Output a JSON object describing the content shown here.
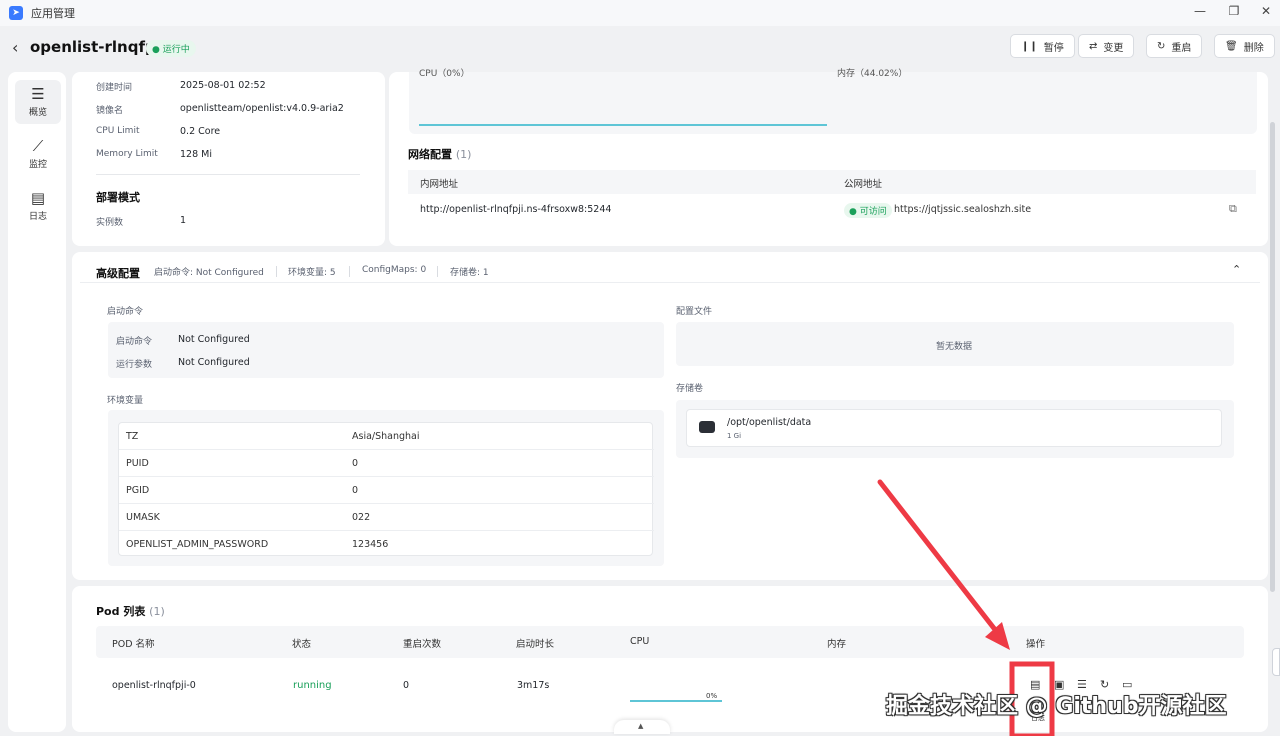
{
  "window": {
    "title": "应用管理"
  },
  "header": {
    "app_name": "openlist-rlnqfpji",
    "status": "运行中",
    "buttons": {
      "pause": "暂停",
      "change": "变更",
      "restart": "重启",
      "delete": "删除"
    }
  },
  "sidebar": {
    "items": [
      {
        "label": "概览"
      },
      {
        "label": "监控"
      },
      {
        "label": "日志"
      }
    ]
  },
  "info": {
    "created_label": "创建时间",
    "created_value": "2025-08-01 02:52",
    "image_label": "镜像名",
    "image_value": "openlistteam/openlist:v4.0.9-aria2",
    "cpu_label": "CPU Limit",
    "cpu_value": "0.2 Core",
    "mem_label": "Memory Limit",
    "mem_value": "128 Mi",
    "deploy_title": "部署模式",
    "replicas_label": "实例数",
    "replicas_value": "1"
  },
  "monitor": {
    "cpu_label": "CPU（0%）",
    "mem_label": "内存（44.02%）"
  },
  "network": {
    "title": "网络配置",
    "count": "(1)",
    "col_internal": "内网地址",
    "col_public": "公网地址",
    "internal": "http://openlist-rlnqfpji.ns-4frsoxw8:5244",
    "public_status": "可访问",
    "public": "https://jqtjssic.sealoshzh.site"
  },
  "advanced": {
    "title": "高级配置",
    "summary": [
      "启动命令: Not Configured",
      "环境变量: 5",
      "ConfigMaps: 0",
      "存储卷: 1"
    ],
    "start_title": "启动命令",
    "cmd_label": "启动命令",
    "cmd_value": "Not Configured",
    "args_label": "运行参数",
    "args_value": "Not Configured",
    "env_title": "环境变量",
    "env": [
      {
        "key": "TZ",
        "value": "Asia/Shanghai"
      },
      {
        "key": "PUID",
        "value": "0"
      },
      {
        "key": "PGID",
        "value": "0"
      },
      {
        "key": "UMASK",
        "value": "022"
      },
      {
        "key": "OPENLIST_ADMIN_PASSWORD",
        "value": "123456"
      }
    ],
    "config_title": "配置文件",
    "config_empty": "暂无数据",
    "storage_title": "存储卷",
    "storage_path": "/opt/openlist/data",
    "storage_size": "1 Gi"
  },
  "pods": {
    "title": "Pod 列表",
    "count": "(1)",
    "headers": [
      "POD 名称",
      "状态",
      "重启次数",
      "启动时长",
      "CPU",
      "内存",
      "操作"
    ],
    "row": {
      "name": "openlist-rlnqfpji-0",
      "status": "running",
      "restarts": "0",
      "uptime": "3m17s",
      "cpu": "0%"
    },
    "log_tooltip": "日志"
  },
  "watermark": "掘金技术社区 @ Github开源社区",
  "colors": {
    "accent": "#3a7afe",
    "running": "#1aa05a",
    "arrow": "#ee3a45",
    "cpu_line": "#5ec5d6"
  }
}
